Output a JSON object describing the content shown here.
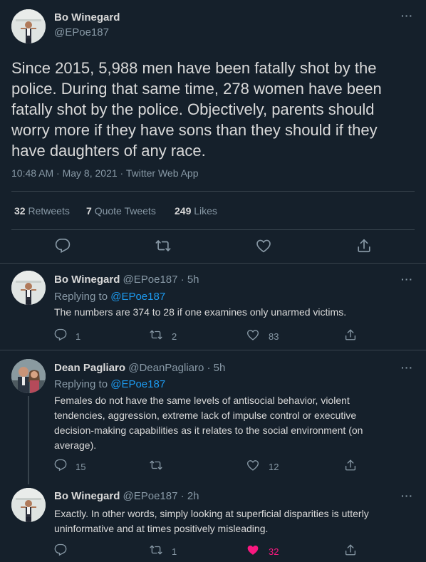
{
  "main_tweet": {
    "author_name": "Bo Winegard",
    "handle": "@EPoe187",
    "text": "Since 2015, 5,988 men have been fatally shot by the police. During that same time, 278 women have been fatally shot by the police. Objectively, parents should worry more if they have sons than they should if they have daughters of any race.",
    "meta": "10:48 AM · May 8, 2021 · Twitter Web App",
    "stats": {
      "retweets_count": "32",
      "retweets_label": "Retweets",
      "quotes_count": "7",
      "quotes_label": "Quote Tweets",
      "likes_count": "249",
      "likes_label": "Likes"
    }
  },
  "replies": [
    {
      "author_name": "Bo Winegard",
      "handle_time": "@EPoe187 · 5h",
      "replying_prefix": "Replying to",
      "replying_to": "@EPoe187",
      "text": "The numbers are 374 to 28 if one examines only unarmed victims.",
      "reply_count": "1",
      "retweet_count": "2",
      "like_count": "83"
    },
    {
      "author_name": "Dean Pagliaro",
      "handle_time": "@DeanPagliaro · 5h",
      "replying_prefix": "Replying to",
      "replying_to": "@EPoe187",
      "text": "Females do not have the same levels of antisocial behavior, violent tendencies, aggression, extreme lack of impulse control or executive decision-making capabilities as it relates to the social environment (on average).",
      "reply_count": "15",
      "retweet_count": "",
      "like_count": "12"
    },
    {
      "author_name": "Bo Winegard",
      "handle_time": "@EPoe187 · 2h",
      "text": "Exactly. In other words, simply looking at superficial disparities is utterly uninformative and at times positively misleading.",
      "reply_count": "",
      "retweet_count": "1",
      "like_count": "32"
    }
  ],
  "colors": {
    "background": "#15202b",
    "text": "#d9d9d9",
    "muted": "#8899a6",
    "link": "#1d9bf0",
    "divider": "#38444d",
    "liked": "#f91880"
  }
}
